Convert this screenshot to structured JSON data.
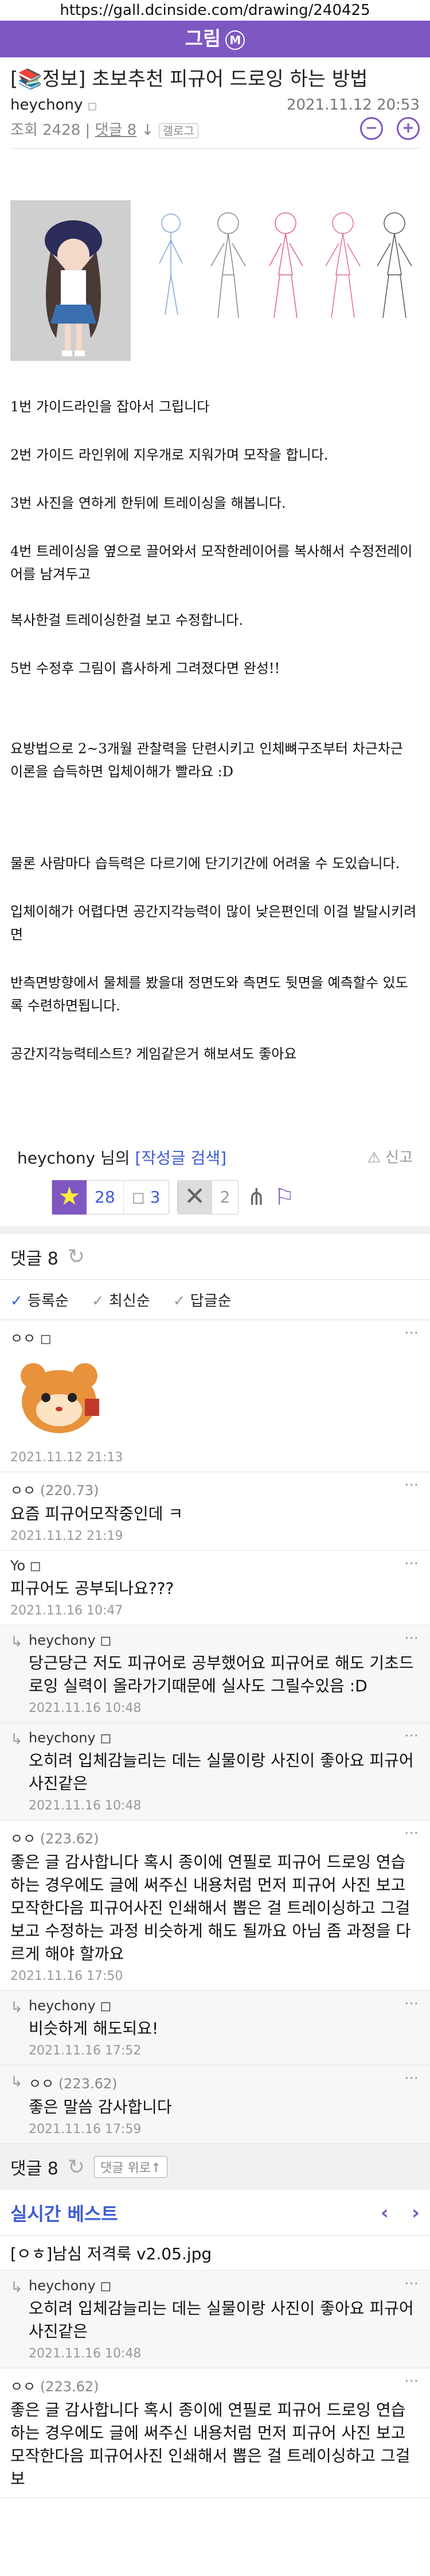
{
  "url": "https://gall.dcinside.com/drawing/240425",
  "gallery": {
    "name": "그림",
    "badge": "M"
  },
  "post": {
    "title": "[📚정보] 초보추천 피규어 드로잉 하는 방법",
    "author": "heychony",
    "date": "2021.11.12 20:53",
    "views_label": "조회 2428",
    "comments_label": "댓글 8",
    "tag_label": "갤로그",
    "paragraphs": [
      "1번 가이드라인을 잡아서 그립니다",
      "2번 가이드 라인위에 지우개로 지워가며 모작을 합니다.",
      "3번 사진을 연하게 한뒤에 트레이싱을 해봅니다.",
      "4번 트레이싱을 옆으로 끌어와서 모작한레이어를 복사해서 수정전레이어를 남겨두고",
      "복사한걸 트레이싱한걸 보고 수정합니다.",
      "5번 수정후 그림이 흡사하게 그려졌다면 완성!!",
      "요방법으로 2~3개월 관찰력을 단련시키고 인체뼈구조부터 차근차근 이론을 습득하면 입체이해가 빨라요 :D",
      "물론 사람마다 습득력은 다르기에 단기기간에 어려울 수 도있습니다.",
      "입체이해가 어렵다면 공간지각능력이 많이 낮은편인데 이걸 발달시키려면",
      "반측면방향에서 물체를 봤을대 정면도와 측면도 뒷면을 예측할수 있도록 수련하면됩니다.",
      "공간지각능력테스트? 게임같은거 해보셔도 좋아요"
    ],
    "author_suffix": "님의",
    "search_link": "[작성글 검색]",
    "report": "신고",
    "recommend": "28",
    "fixed_recommend": "3",
    "not_recommend": "2"
  },
  "comments": {
    "header": "댓글 8",
    "sorts": [
      "등록순",
      "최신순",
      "답글순"
    ],
    "items": [
      {
        "nick": "ㅇㅇ",
        "ip": "",
        "body": "",
        "date": "2021.11.12 21:13",
        "reply": false,
        "image": true
      },
      {
        "nick": "ㅇㅇ",
        "ip": "(220.73)",
        "body": "요즘 피규어모작중인데 ㅋ",
        "date": "2021.11.12 21:19",
        "reply": false
      },
      {
        "nick": "Yo",
        "ip": "",
        "body": "피규어도 공부되나요???",
        "date": "2021.11.16 10:47",
        "reply": false
      },
      {
        "nick": "heychony",
        "ip": "",
        "body": "당근당근 저도 피규어로 공부했어요 피규어로 해도 기초드로잉 실력이 올라가기때문에 실사도 그릴수있음 :D",
        "date": "2021.11.16 10:48",
        "reply": true
      },
      {
        "nick": "heychony",
        "ip": "",
        "body": "오히려 입체감늘리는 데는 실물이랑 사진이 좋아요 피규어 사진같은",
        "date": "2021.11.16 10:48",
        "reply": true
      },
      {
        "nick": "ㅇㅇ",
        "ip": "(223.62)",
        "body": "좋은 글 감사합니다 혹시 종이에 연필로 피규어 드로잉 연습하는 경우에도 글에 써주신 내용처럼 먼저 피규어 사진 보고 모작한다음 피규어사진 인쇄해서 뽑은 걸 트레이싱하고 그걸 보고 수정하는 과정 비슷하게 해도 될까요 아님 좀 과정을 다르게 해야 할까요",
        "date": "2021.11.16 17:50",
        "reply": false
      },
      {
        "nick": "heychony",
        "ip": "",
        "body": "비슷하게 해도되요!",
        "date": "2021.11.16 17:52",
        "reply": true
      },
      {
        "nick": "ㅇㅇ",
        "ip": "(223.62)",
        "body": "좋은 말씀 감사합니다",
        "date": "2021.11.16 17:59",
        "reply": true
      }
    ],
    "bottom_label": "댓글 8",
    "up_label": "댓글 위로↑"
  },
  "best": {
    "title": "실시간 베스트",
    "first_item": "[ㅇㅎ]남심 저격룩 v2.05.jpg"
  },
  "overlay": [
    {
      "nick": "heychony",
      "body": "오히려 입체감늘리는 데는 실물이랑 사진이 좋아요 피규어 사진같은",
      "date": "2021.11.16 10:48",
      "reply": true
    },
    {
      "nick": "ㅇㅇ",
      "ip": "(223.62)",
      "body": "좋은 글 감사합니다 혹시 종이에 연필로 피규어 드로잉 연습하는 경우에도 글에 써주신 내용처럼 먼저 피규어 사진 보고 모작한다음 피규어사진 인쇄해서 뽑은 걸 트레이싱하고 그걸 보",
      "date": "",
      "reply": false
    }
  ]
}
